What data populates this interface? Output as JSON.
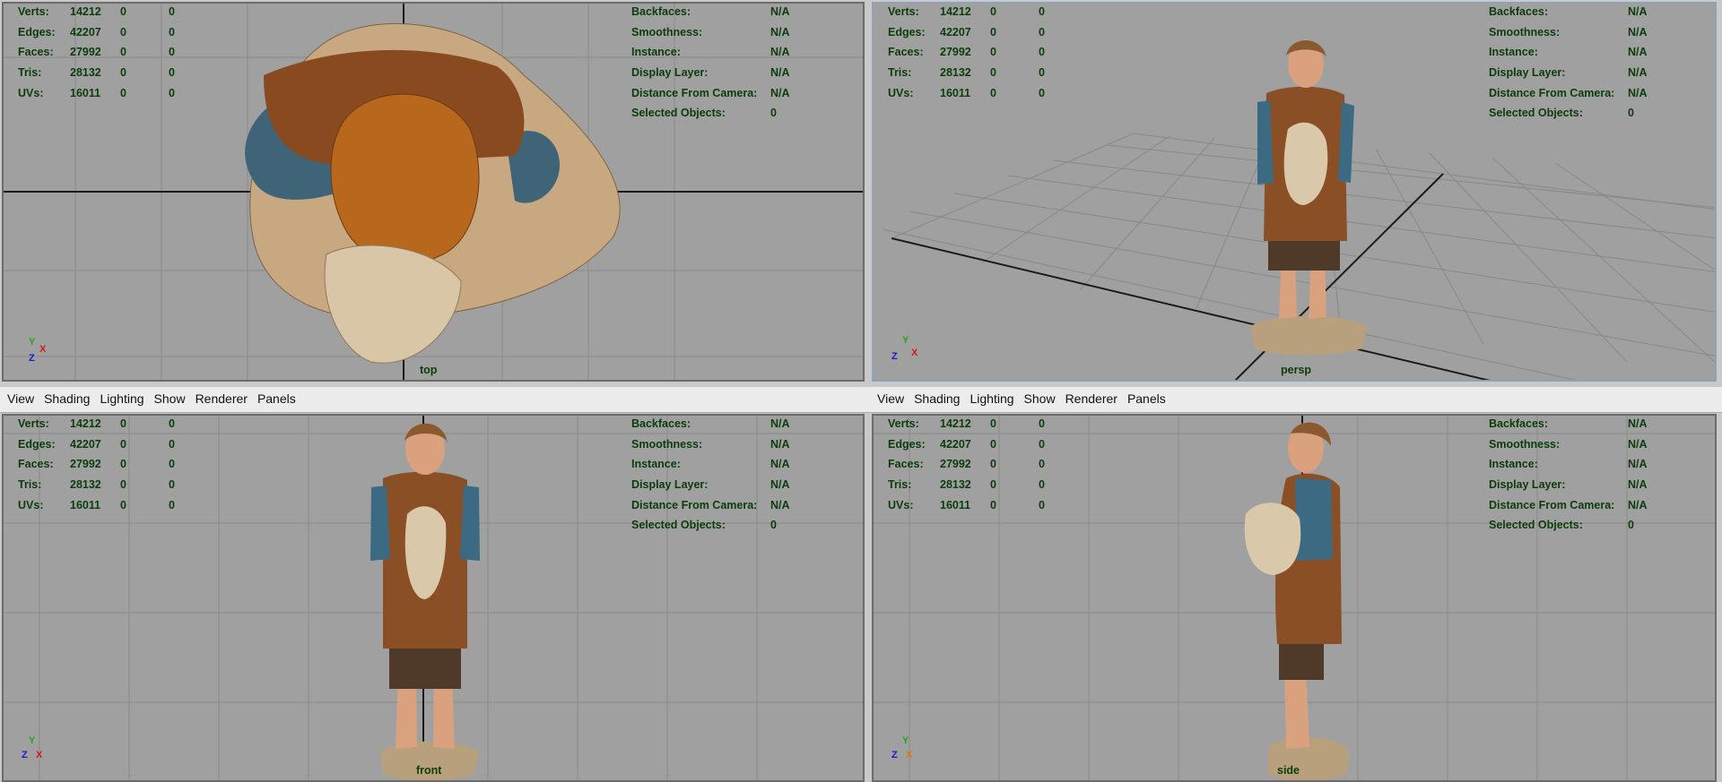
{
  "menu": [
    "View",
    "Shading",
    "Lighting",
    "Show",
    "Renderer",
    "Panels"
  ],
  "stats": {
    "rows": [
      {
        "label": "Verts:",
        "v1": "14212",
        "v2": "0",
        "v3": "0"
      },
      {
        "label": "Edges:",
        "v1": "42207",
        "v2": "0",
        "v3": "0"
      },
      {
        "label": "Faces:",
        "v1": "27992",
        "v2": "0",
        "v3": "0"
      },
      {
        "label": "Tris:",
        "v1": "28132",
        "v2": "0",
        "v3": "0"
      },
      {
        "label": "UVs:",
        "v1": "16011",
        "v2": "0",
        "v3": "0"
      }
    ]
  },
  "info": {
    "rows": [
      {
        "label": "Backfaces:",
        "value": "N/A"
      },
      {
        "label": "Smoothness:",
        "value": "N/A"
      },
      {
        "label": "Instance:",
        "value": "N/A"
      },
      {
        "label": "Display Layer:",
        "value": "N/A"
      },
      {
        "label": "Distance From Camera:",
        "value": "N/A"
      },
      {
        "label": "Selected Objects:",
        "value": "0"
      }
    ]
  },
  "viewports": {
    "top": {
      "camera": "top",
      "axes": [
        "Y",
        "X",
        "Z"
      ]
    },
    "persp": {
      "camera": "persp",
      "axes": [
        "Y",
        "Z",
        "X"
      ]
    },
    "front": {
      "camera": "front",
      "axes": [
        "Y",
        "Z",
        "X"
      ]
    },
    "side": {
      "camera": "side",
      "axes": [
        "Y",
        "Z",
        "X"
      ]
    }
  },
  "colors": {
    "hud": "#0b3d0b",
    "viewport_bg": "#a0a0a0",
    "menubar_bg": "#ececec"
  }
}
